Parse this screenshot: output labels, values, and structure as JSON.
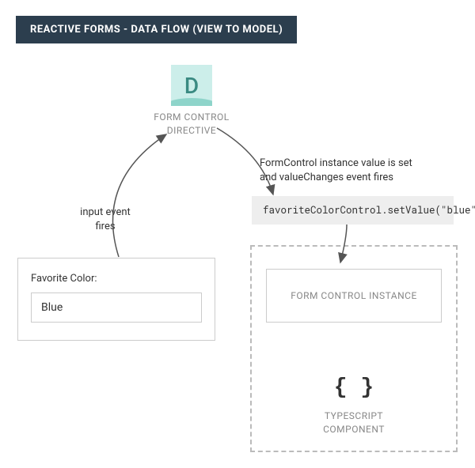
{
  "title": "REACTIVE FORMS - DATA FLOW (VIEW TO MODEL)",
  "directive": {
    "icon_letter": "D",
    "label_line1": "FORM CONTROL",
    "label_line2": "DIRECTIVE"
  },
  "annotations": {
    "right_line1": "FormControl instance value is set",
    "right_line2": "and valueChanges event fires",
    "left_line1": "input event",
    "left_line2": "fires"
  },
  "code": "favoriteColorControl.setValue(\"blue\")",
  "form": {
    "label": "Favorite Color:",
    "value": "Blue"
  },
  "instance": {
    "label": "FORM CONTROL INSTANCE"
  },
  "component": {
    "symbol": "{ }",
    "label_line1": "TYPESCRIPT",
    "label_line2": "COMPONENT"
  }
}
